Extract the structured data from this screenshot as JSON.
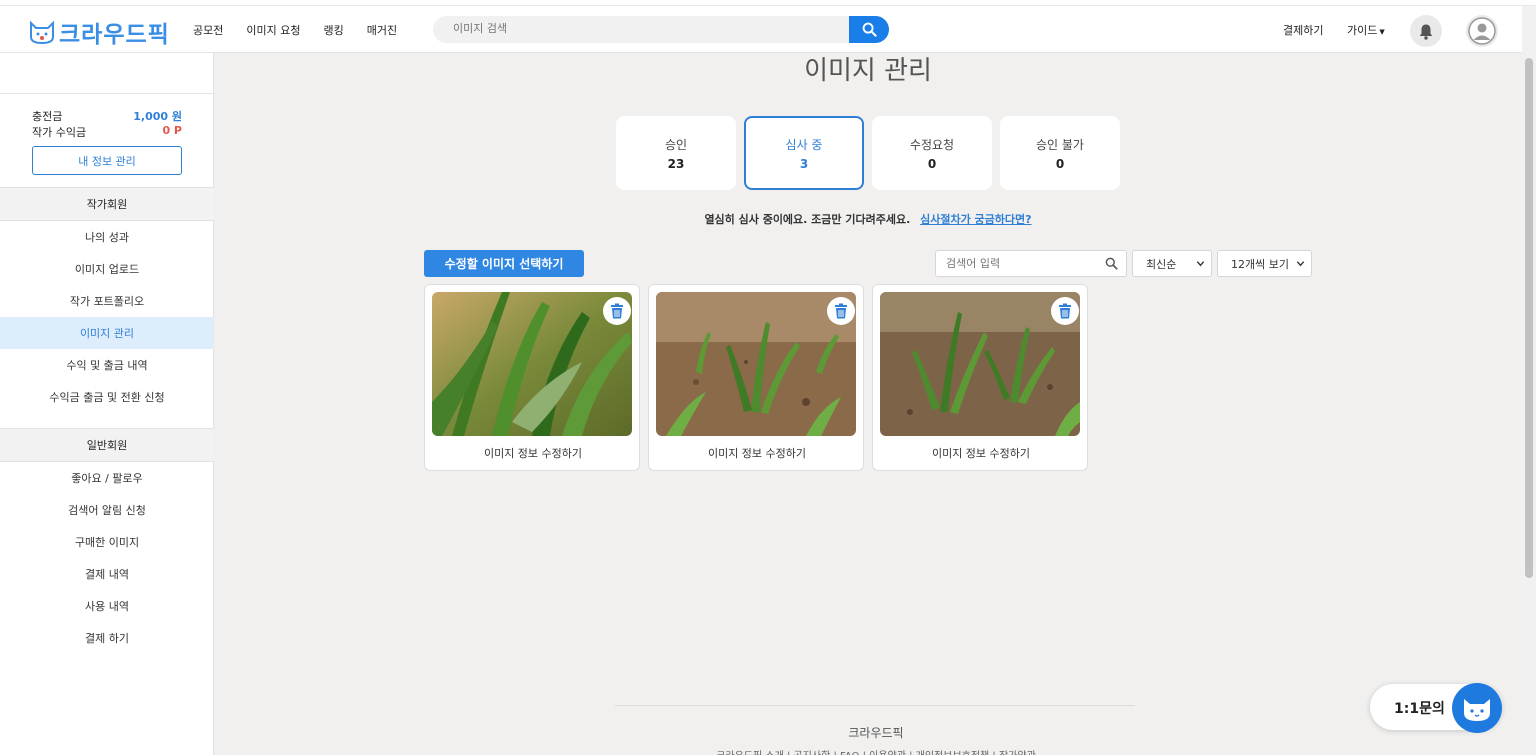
{
  "header": {
    "logo_text": "크라우드픽",
    "nav": [
      "공모전",
      "이미지 요청",
      "랭킹",
      "매거진"
    ],
    "search_placeholder": "이미지 검색",
    "payment": "결제하기",
    "guide": "가이드"
  },
  "sidebar": {
    "username": " ",
    "charge_label": "충전금",
    "charge_value": "1,000 원",
    "earnings_label": "작가 수익금",
    "earnings_value": "0 P",
    "my_info_button": "내 정보 관리",
    "artist_section": "작가회원",
    "artist_items": [
      "나의 성과",
      "이미지 업로드",
      "작가 포트폴리오",
      "이미지 관리",
      "수익 및 출금 내역",
      "수익금 출금 및 전환 신청"
    ],
    "general_section": "일반회원",
    "general_items": [
      "좋아요 / 팔로우",
      "검색어 알림 신청",
      "구매한 이미지",
      "결제 내역",
      "사용 내역",
      "결제 하기"
    ]
  },
  "main": {
    "title": "이미지 관리",
    "status_cards": [
      {
        "label": "승인",
        "count": "23"
      },
      {
        "label": "심사 중",
        "count": "3"
      },
      {
        "label": "수정요청",
        "count": "0"
      },
      {
        "label": "승인 불가",
        "count": "0"
      }
    ],
    "info_text": "열심히 심사 중이에요. 조금만 기다려주세요.",
    "info_link": "심사절차가 궁금하다면?",
    "select_button": "수정할 이미지 선택하기",
    "keyword_placeholder": "검색어 입력",
    "sort_selected": "최신순",
    "per_page_selected": "12개씩 보기",
    "images": [
      {
        "caption": "이미지 정보 수정하기"
      },
      {
        "caption": "이미지 정보 수정하기"
      },
      {
        "caption": "이미지 정보 수정하기"
      }
    ]
  },
  "footer": {
    "title": "크라우드픽",
    "links": "크라우드픽 소개 | 공지사항 | FAQ | 이용약관 | 개인정보보호정책 | 작가약관"
  },
  "chat": {
    "label": "1:1문의"
  },
  "colors": {
    "accent": "#2f7fd6",
    "brand": "#3a8ee6",
    "earnings": "#e0594b"
  }
}
